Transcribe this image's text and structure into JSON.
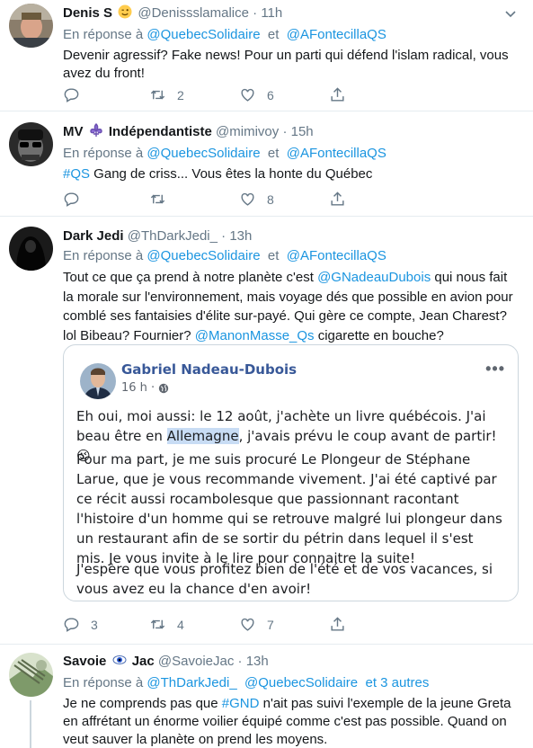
{
  "tweets": [
    {
      "name": "Denis S",
      "handle": "@Denissslamalice",
      "time": "11h",
      "reply_prefix": "En réponse à",
      "reply_to": [
        "@QuebecSolidaire",
        "@AFontecillaQS"
      ],
      "reply_joiner": "et",
      "text": "Devenir agressif? Fake news!  Pour un parti qui défend l'islam radical, vous avez du front!",
      "replies": "",
      "retweets": "2",
      "likes": "6"
    },
    {
      "name": "MV",
      "name_suffix": "Indépendantiste",
      "handle": "@mimivoy",
      "time": "15h",
      "reply_prefix": "En réponse à",
      "reply_to": [
        "@QuebecSolidaire",
        "@AFontecillaQS"
      ],
      "reply_joiner": "et",
      "hashtag": "#QS",
      "text": " Gang de criss... Vous êtes la honte du Québec",
      "replies": "",
      "retweets": "",
      "likes": "8"
    },
    {
      "name": "Dark Jedi",
      "handle": "@ThDarkJedi_",
      "time": "13h",
      "reply_prefix": "En réponse à",
      "reply_to": [
        "@QuebecSolidaire",
        "@AFontecillaQS"
      ],
      "reply_joiner": "et",
      "text_a": "Tout ce que ça prend à notre planète c'est ",
      "mention_1": "@GNadeauDubois",
      "text_b": " qui nous fait la morale sur l'environnement, mais voyage dés que possible en avion pour comblé ses fantaisies  d'élite sur-payé. Qui gère ce compte, Jean Charest? lol Bibeau? Fournier? ",
      "mention_2": "@ManonMasse_Qs",
      "text_c": " cigarette en bouche?",
      "replies": "3",
      "retweets": "4",
      "likes": "7",
      "embed": {
        "author": "Gabriel Nadeau-Dubois",
        "meta": "16 h ·",
        "p1_a": "Eh oui, moi aussi: le 12 août, j'achète un livre québécois. J'ai beau être en ",
        "p1_hl": "Allemagne",
        "p1_b": ", j'avais prévu le coup avant de partir! 😉",
        "p2": "Pour ma part, je me suis procuré Le Plongeur de Stéphane Larue, que je vous recommande vivement. J'ai été captivé par ce récit aussi rocambolesque que passionnant racontant l'histoire d'un homme qui se retrouve malgré lui plongeur dans un restaurant afin de se sortir du pétrin dans lequel il s'est mis. Je vous invite à le lire pour connaitre la suite!",
        "p3": "J'espère que vous profitez bien de l'été et de vos vacances, si vous avez eu la chance d'en avoir!"
      }
    },
    {
      "name": "Savoie",
      "name_suffix": "Jac",
      "handle": "@SavoieJac",
      "time": "13h",
      "reply_prefix": "En réponse à",
      "reply_to": [
        "@ThDarkJedi_",
        "@QuebecSolidaire"
      ],
      "reply_more": "et 3 autres",
      "text_a": "Je ne comprends pas que ",
      "hashtag": "#GND",
      "text_b": " n'ait pas suivi l'exemple de la jeune Greta en affrétant un énorme voilier équipé comme c'est pas possible. Quand on veut sauver la planète on prend les moyens."
    }
  ],
  "separator": "·",
  "colors": {
    "link": "#1b95e0",
    "muted": "#657786",
    "fb_blue": "#385898"
  }
}
